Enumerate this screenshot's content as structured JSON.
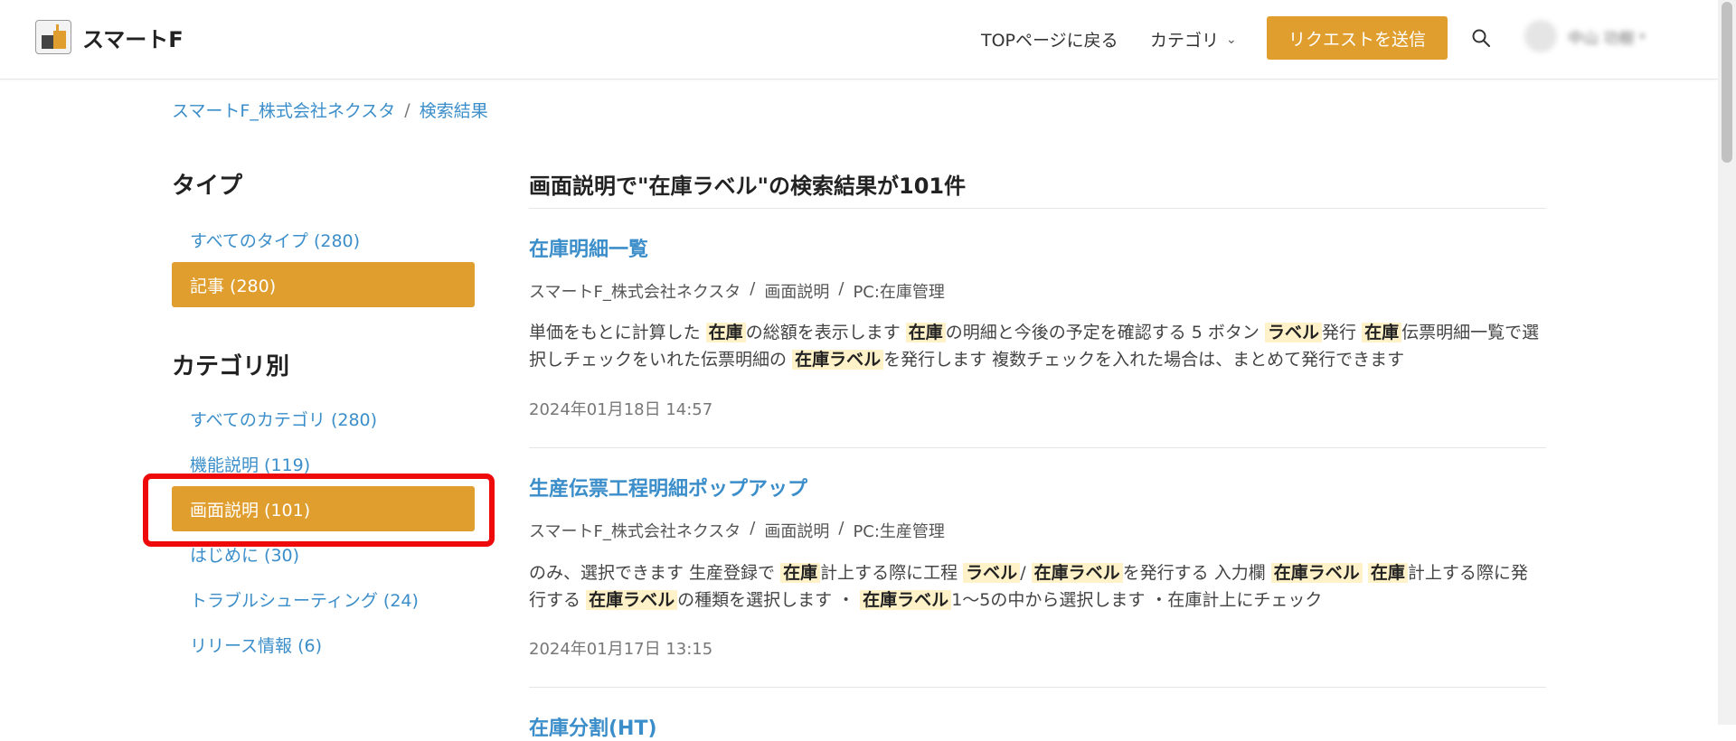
{
  "header": {
    "logo_text": "スマートF",
    "nav_top": "TOPページに戻る",
    "nav_category": "カテゴリ",
    "request_button": "リクエストを送信",
    "user_name": "中山 功樹"
  },
  "breadcrumb": {
    "items": [
      "スマートF_株式会社ネクスタ",
      "検索結果"
    ],
    "separator": "/"
  },
  "sidebar": {
    "type_heading": "タイプ",
    "type_items": [
      {
        "label": "すべてのタイプ (280)"
      },
      {
        "label": "記事 (280)"
      }
    ],
    "category_heading": "カテゴリ別",
    "category_items": [
      {
        "label": "すべてのカテゴリ (280)"
      },
      {
        "label": "機能説明 (119)"
      },
      {
        "label": "画面説明 (101)"
      },
      {
        "label": "はじめに (30)"
      },
      {
        "label": "トラブルシューティング (24)"
      },
      {
        "label": "リリース情報 (6)"
      }
    ]
  },
  "main": {
    "heading": "画面説明で\"在庫ラベル\"の検索結果が101件",
    "results": [
      {
        "title": "在庫明細一覧",
        "crumbs": [
          "スマートF_株式会社ネクスタ",
          "画面説明",
          "PC:在庫管理"
        ],
        "snippet": [
          {
            "t": "単価をもとに計算した"
          },
          {
            "t": "在庫",
            "h": true
          },
          {
            "t": "の総額を表示します"
          },
          {
            "t": "在庫",
            "h": true
          },
          {
            "t": "の明細と今後の予定を確認する 5 ボタン"
          },
          {
            "t": "ラベル",
            "h": true
          },
          {
            "t": "発行"
          },
          {
            "t": "在庫",
            "h": true
          },
          {
            "t": "伝票明細一覧で選択しチェックをいれた伝票明細の"
          },
          {
            "t": "在庫ラベル",
            "h": true
          },
          {
            "t": "を発行します 複数チェックを入れた場合は、まとめて発行できます"
          }
        ],
        "date": "2024年01月18日 14:57"
      },
      {
        "title": "生産伝票工程明細ポップアップ",
        "crumbs": [
          "スマートF_株式会社ネクスタ",
          "画面説明",
          "PC:生産管理"
        ],
        "snippet": [
          {
            "t": "のみ、選択できます 生産登録で"
          },
          {
            "t": "在庫",
            "h": true
          },
          {
            "t": "計上する際に工程"
          },
          {
            "t": "ラベル",
            "h": true
          },
          {
            "t": "/"
          },
          {
            "t": "在庫ラベル",
            "h": true
          },
          {
            "t": "を発行する 入力欄"
          },
          {
            "t": "在庫ラベル",
            "h": true
          },
          {
            "t": ""
          },
          {
            "t": "在庫",
            "h": true
          },
          {
            "t": "計上する際に発行する"
          },
          {
            "t": "在庫ラベル",
            "h": true
          },
          {
            "t": "の種類を選択します ・"
          },
          {
            "t": "在庫ラベル",
            "h": true
          },
          {
            "t": "1～5の中から選択します ・在庫計上にチェック"
          }
        ],
        "date": "2024年01月17日 13:15"
      },
      {
        "title": "在庫分割(HT)"
      }
    ]
  },
  "colors": {
    "accent": "#e09e2e",
    "link": "#3b8ec9",
    "highlight_frame": "#ee0a0a",
    "mark_bg": "#fff2c9"
  }
}
